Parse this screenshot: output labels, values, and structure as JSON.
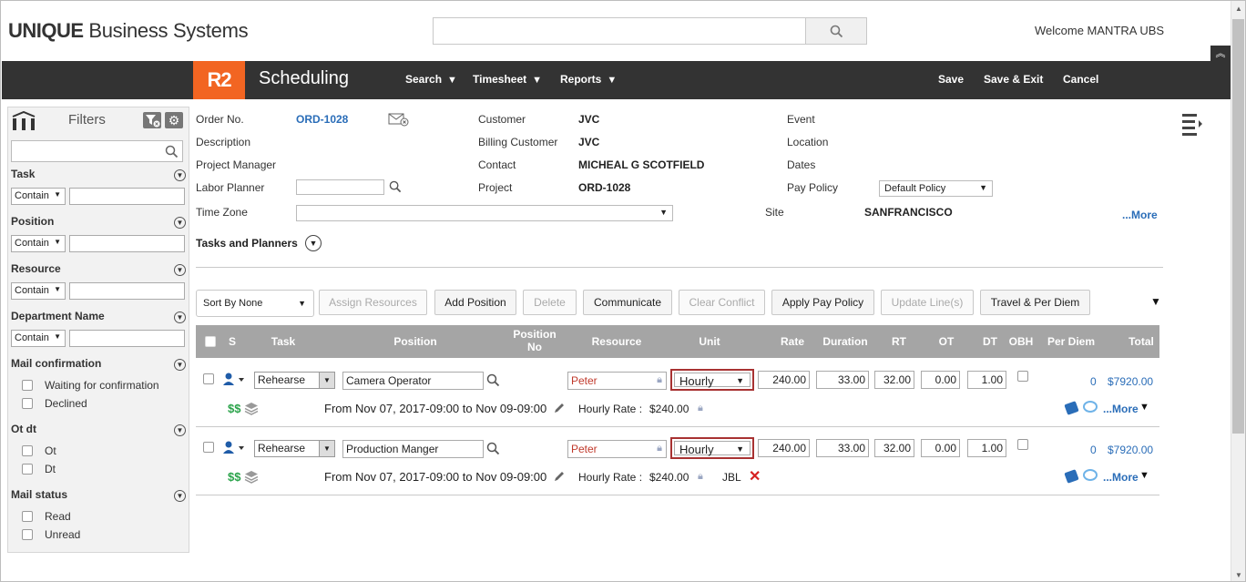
{
  "header": {
    "logo_bold": "UNIQUE",
    "logo_rest": " Business Systems",
    "search_placeholder": "",
    "welcome": "Welcome MANTRA UBS"
  },
  "navbar": {
    "badge": "R2",
    "title": "Scheduling",
    "menus": [
      "Search",
      "Timesheet",
      "Reports"
    ],
    "actions": {
      "save": "Save",
      "save_exit": "Save & Exit",
      "cancel": "Cancel"
    }
  },
  "sidebar": {
    "title": "Filters",
    "groups": [
      {
        "label": "Task",
        "op": "Contain"
      },
      {
        "label": "Position",
        "op": "Contain"
      },
      {
        "label": "Resource",
        "op": "Contain"
      },
      {
        "label": "Department Name",
        "op": "Contain"
      }
    ],
    "mail_confirmation": {
      "label": "Mail confirmation",
      "options": [
        "Waiting for confirmation",
        "Declined"
      ]
    },
    "ot_dt": {
      "label": "Ot dt",
      "options": [
        "Ot",
        "Dt"
      ]
    },
    "mail_status": {
      "label": "Mail status",
      "options": [
        "Read",
        "Unread"
      ]
    }
  },
  "order": {
    "order_no_label": "Order No.",
    "order_no": "ORD-1028",
    "description_label": "Description",
    "pm_label": "Project Manager",
    "labor_planner_label": "Labor Planner",
    "time_zone_label": "Time Zone",
    "customer_label": "Customer",
    "customer": "JVC",
    "billing_label": "Billing Customer",
    "billing": "JVC",
    "contact_label": "Contact",
    "contact": "MICHEAL G SCOTFIELD",
    "project_label": "Project",
    "project": "ORD-1028",
    "event_label": "Event",
    "location_label": "Location",
    "dates_label": "Dates",
    "pay_policy_label": "Pay Policy",
    "pay_policy": "Default Policy",
    "site_label": "Site",
    "site": "SANFRANCISCO",
    "more": "...More",
    "tasks_planners": "Tasks and Planners"
  },
  "toolbar": {
    "sort": "Sort By None",
    "assign": "Assign Resources",
    "add_position": "Add Position",
    "delete": "Delete",
    "communicate": "Communicate",
    "clear_conflict": "Clear Conflict",
    "apply_pay_policy": "Apply Pay Policy",
    "update_lines": "Update Line(s)",
    "travel": "Travel & Per Diem"
  },
  "table": {
    "columns": [
      "S",
      "Task",
      "Position",
      "Position No",
      "Resource",
      "Unit",
      "Rate",
      "Duration",
      "RT",
      "OT",
      "DT",
      "OBH",
      "Per Diem",
      "Total"
    ],
    "rows": [
      {
        "task": "Rehearse",
        "position": "Camera Operator",
        "resource": "Peter",
        "unit": "Hourly",
        "rate": "240.00",
        "duration": "33.00",
        "rt": "32.00",
        "ot": "0.00",
        "dt": "1.00",
        "per_diem": "0",
        "total": "$7920.00",
        "range": "From Nov 07, 2017-09:00 to Nov 09-09:00",
        "hourly_label": "Hourly Rate :",
        "hourly": "$240.00",
        "vendor": "",
        "more": "...More"
      },
      {
        "task": "Rehearse",
        "position": "Production Manger",
        "resource": "Peter",
        "unit": "Hourly",
        "rate": "240.00",
        "duration": "33.00",
        "rt": "32.00",
        "ot": "0.00",
        "dt": "1.00",
        "per_diem": "0",
        "total": "$7920.00",
        "range": "From Nov 07, 2017-09:00 to Nov 09-09:00",
        "hourly_label": "Hourly Rate :",
        "hourly": "$240.00",
        "vendor": "JBL",
        "more": "...More"
      }
    ]
  },
  "colors": {
    "navbar": "#333333",
    "accent": "#f26522",
    "link": "#2a6db8",
    "header_row": "#a5a5a5",
    "money": "#2aa34a"
  }
}
